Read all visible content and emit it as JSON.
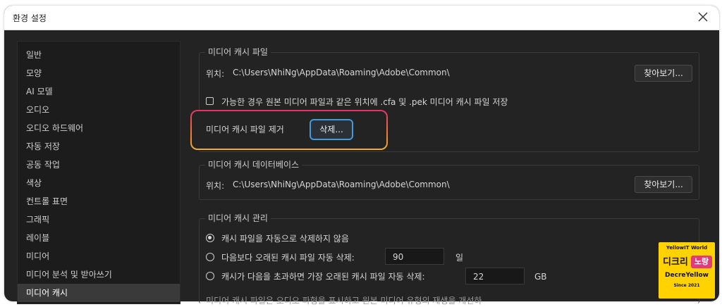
{
  "window": {
    "title": "환경 설정"
  },
  "sidebar": {
    "items": [
      {
        "label": "일반"
      },
      {
        "label": "모양"
      },
      {
        "label": "AI 모델"
      },
      {
        "label": "오디오"
      },
      {
        "label": "오디오 하드웨어"
      },
      {
        "label": "자동 저장"
      },
      {
        "label": "공동 작업"
      },
      {
        "label": "색상"
      },
      {
        "label": "컨트롤 표면"
      },
      {
        "label": "그래픽"
      },
      {
        "label": "레이블"
      },
      {
        "label": "미디어"
      },
      {
        "label": "미디어 분석 및 받아쓰기"
      },
      {
        "label": "미디어 캐시"
      }
    ],
    "selected": "미디어 캐시"
  },
  "media_cache_files": {
    "title": "미디어 캐시 파일",
    "location_label": "위치:",
    "location_path": "C:\\Users\\NhiNg\\AppData\\Roaming\\Adobe\\Common\\",
    "browse_label": "찾아보기...",
    "checkbox_label": "가능한 경우 원본 미디어 파일과 같은 위치에 .cfa 및 .pek 미디어 캐시 파일 저장",
    "checkbox_checked": false,
    "remove_label": "미디어 캐시 파일 제거",
    "delete_label": "삭제..."
  },
  "media_cache_db": {
    "title": "미디어 캐시 데이터베이스",
    "location_label": "위치:",
    "location_path": "C:\\Users\\NhiNg\\AppData\\Roaming\\Adobe\\Common\\",
    "browse_label": "찾아보기..."
  },
  "media_cache_mgmt": {
    "title": "미디어 캐시 관리",
    "option1": "캐시 파일을 자동으로 삭제하지 않음",
    "option2": "다음보다 오래된 캐시 파일 자동 삭제:",
    "option2_value": "90",
    "option2_unit": "일",
    "option3": "캐시가 다음을 초과하면 가장 오래된 캐시 파일 자동 삭제:",
    "option3_value": "22",
    "option3_unit": "GB",
    "selected_option": 1
  },
  "footer_text": "미디어 캐시 파일은 오디오 파형을 표시하고 원본 미디어 유형의 재생을 개선하",
  "watermark": {
    "top": "YellowIT World",
    "korean_left": "디크리",
    "korean_right": "노랑",
    "middle": "DecreYellow",
    "bottom": "Since 2021"
  },
  "colors": {
    "dialog_bg": "#232323",
    "sidebar_selected": "#3a3a3a",
    "highlight_gradient": [
      "#e8306c",
      "#f07a36",
      "#f0b030"
    ],
    "delete_border": "#3f9bdb",
    "watermark_bg": "#ffd200"
  },
  "icons": {
    "close": "close-icon",
    "checkbox": "checkbox-icon",
    "radio": "radio-icon"
  }
}
